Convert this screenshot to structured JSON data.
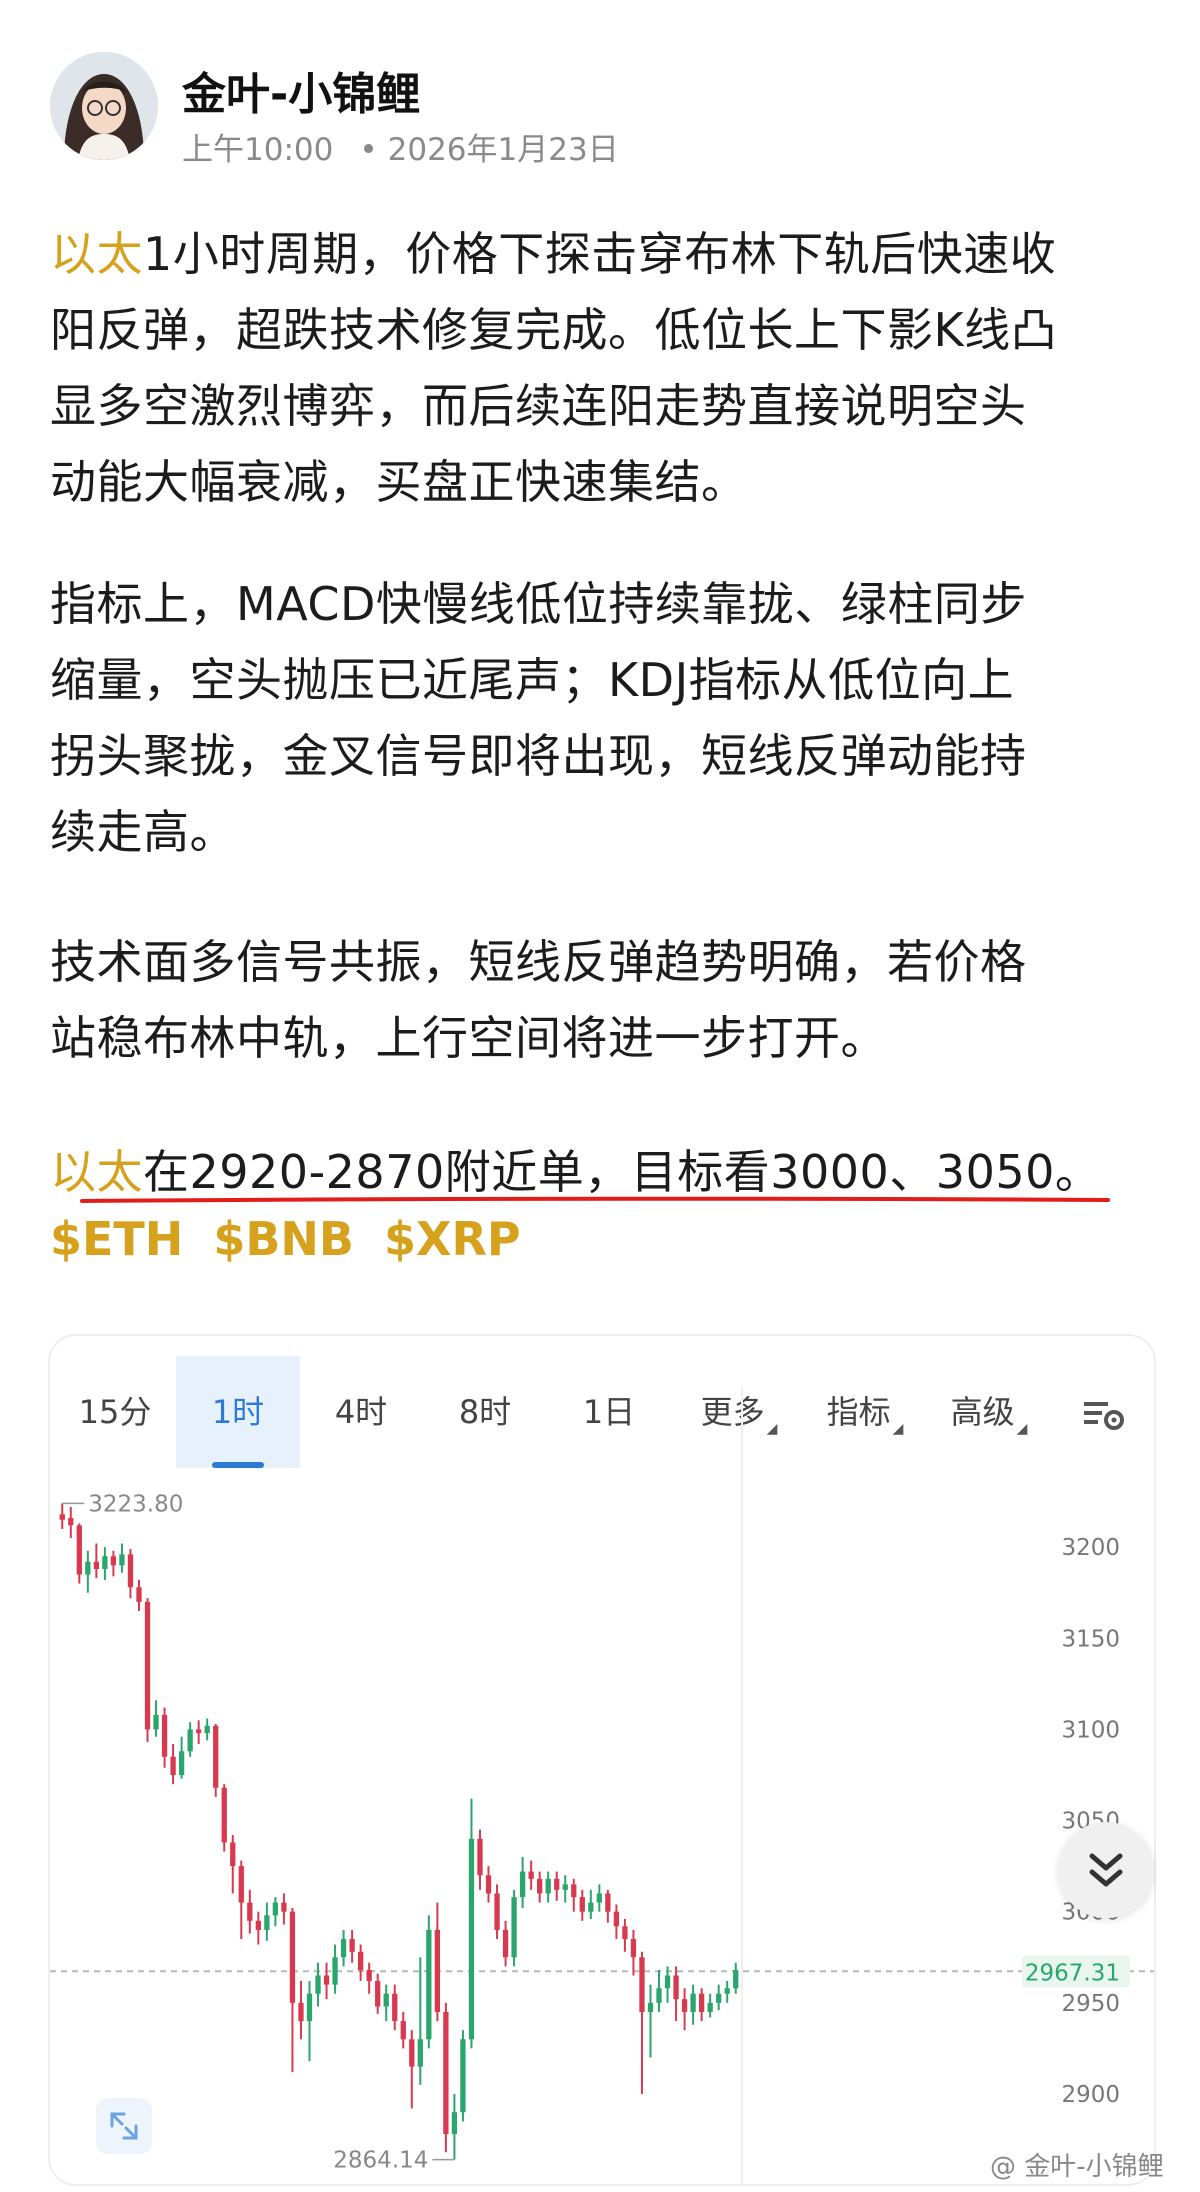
{
  "post": {
    "author": "金叶-小锦鲤",
    "time": "上午10:00",
    "date": "2026年1月23日"
  },
  "content": {
    "p1_highlight": "以太",
    "p1_lines": [
      "1小时周期，价格下探击穿布林下轨后快速收",
      "阳反弹，超跌技术修复完成。低位长上下影K线凸",
      "显多空激烈博弈，而后续连阳走势直接说明空头",
      "动能大幅衰减，买盘正快速集结。"
    ],
    "p2_lines": [
      "指标上，MACD快慢线低位持续靠拢、绿柱同步",
      "缩量，空头抛压已近尾声；KDJ指标从低位向上",
      "拐头聚拢，金叉信号即将出现，短线反弹动能持",
      "续走高。"
    ],
    "p3_lines": [
      "技术面多信号共振，短线反弹趋势明确，若价格",
      "站稳布林中轨，上行空间将进一步打开。"
    ],
    "p4_highlight": "以太",
    "p4_text": "在2920-2870附近单，目标看3000、3050。",
    "tags": [
      "$ETH",
      "$BNB",
      "$XRP"
    ]
  },
  "chart_ui": {
    "tabs": [
      "15分",
      "1时",
      "4时",
      "8时",
      "1日",
      "更多",
      "指标",
      "高级"
    ],
    "active_tab": "1时",
    "settings_icon": "chart-settings-icon",
    "scroll_icon": "double-chevron-down-icon",
    "expand_icon": "expand-arrows-icon",
    "watermark": "@ 金叶-小锦鲤",
    "colors": {
      "up": "#2aa56b",
      "down": "#d9394f",
      "accent": "#d6a21e",
      "active_tab": "#2b7bd6"
    }
  },
  "chart_data": {
    "type": "candlestick",
    "title": "",
    "xlabel": "",
    "ylabel": "",
    "ylim": [
      2855,
      3250
    ],
    "y_ticks": [
      3200,
      3150,
      3100,
      3050,
      3000,
      2950,
      2900
    ],
    "y_tick_labels": [
      "3200",
      "3150",
      "3100",
      "3050",
      "3000",
      "2950",
      "2900"
    ],
    "high_label": "3223.80",
    "low_label": "2864.14",
    "current_price": 2967.31,
    "current_price_label": "2967.31",
    "grid": false,
    "candles": [
      {
        "o": 3218,
        "c": 3215,
        "h": 3224,
        "l": 3210
      },
      {
        "o": 3216,
        "c": 3212,
        "h": 3222,
        "l": 3205
      },
      {
        "o": 3212,
        "c": 3185,
        "h": 3213,
        "l": 3180
      },
      {
        "o": 3185,
        "c": 3192,
        "h": 3198,
        "l": 3175
      },
      {
        "o": 3192,
        "c": 3188,
        "h": 3202,
        "l": 3183
      },
      {
        "o": 3188,
        "c": 3195,
        "h": 3200,
        "l": 3182
      },
      {
        "o": 3195,
        "c": 3190,
        "h": 3198,
        "l": 3184
      },
      {
        "o": 3190,
        "c": 3196,
        "h": 3202,
        "l": 3186
      },
      {
        "o": 3196,
        "c": 3178,
        "h": 3199,
        "l": 3172
      },
      {
        "o": 3178,
        "c": 3170,
        "h": 3182,
        "l": 3165
      },
      {
        "o": 3170,
        "c": 3100,
        "h": 3172,
        "l": 3093
      },
      {
        "o": 3100,
        "c": 3108,
        "h": 3116,
        "l": 3096
      },
      {
        "o": 3108,
        "c": 3085,
        "h": 3112,
        "l": 3079
      },
      {
        "o": 3085,
        "c": 3075,
        "h": 3092,
        "l": 3070
      },
      {
        "o": 3075,
        "c": 3088,
        "h": 3096,
        "l": 3073
      },
      {
        "o": 3088,
        "c": 3100,
        "h": 3104,
        "l": 3085
      },
      {
        "o": 3100,
        "c": 3098,
        "h": 3105,
        "l": 3092
      },
      {
        "o": 3098,
        "c": 3102,
        "h": 3106,
        "l": 3094
      },
      {
        "o": 3102,
        "c": 3068,
        "h": 3103,
        "l": 3063
      },
      {
        "o": 3068,
        "c": 3038,
        "h": 3070,
        "l": 3033
      },
      {
        "o": 3038,
        "c": 3025,
        "h": 3042,
        "l": 3010
      },
      {
        "o": 3025,
        "c": 3005,
        "h": 3028,
        "l": 2985
      },
      {
        "o": 3005,
        "c": 2995,
        "h": 3012,
        "l": 2988
      },
      {
        "o": 2995,
        "c": 2990,
        "h": 3000,
        "l": 2982
      },
      {
        "o": 2990,
        "c": 2998,
        "h": 3005,
        "l": 2984
      },
      {
        "o": 2998,
        "c": 3005,
        "h": 3008,
        "l": 2992
      },
      {
        "o": 3005,
        "c": 3000,
        "h": 3010,
        "l": 2993
      },
      {
        "o": 3000,
        "c": 2950,
        "h": 3002,
        "l": 2912
      },
      {
        "o": 2950,
        "c": 2940,
        "h": 2962,
        "l": 2930
      },
      {
        "o": 2940,
        "c": 2955,
        "h": 2962,
        "l": 2918
      },
      {
        "o": 2955,
        "c": 2965,
        "h": 2972,
        "l": 2948
      },
      {
        "o": 2965,
        "c": 2960,
        "h": 2972,
        "l": 2952
      },
      {
        "o": 2960,
        "c": 2975,
        "h": 2982,
        "l": 2955
      },
      {
        "o": 2975,
        "c": 2985,
        "h": 2990,
        "l": 2970
      },
      {
        "o": 2985,
        "c": 2978,
        "h": 2990,
        "l": 2972
      },
      {
        "o": 2978,
        "c": 2968,
        "h": 2982,
        "l": 2962
      },
      {
        "o": 2968,
        "c": 2962,
        "h": 2972,
        "l": 2955
      },
      {
        "o": 2962,
        "c": 2948,
        "h": 2966,
        "l": 2944
      },
      {
        "o": 2948,
        "c": 2955,
        "h": 2960,
        "l": 2940
      },
      {
        "o": 2955,
        "c": 2940,
        "h": 2960,
        "l": 2935
      },
      {
        "o": 2940,
        "c": 2930,
        "h": 2945,
        "l": 2925
      },
      {
        "o": 2930,
        "c": 2915,
        "h": 2935,
        "l": 2892
      },
      {
        "o": 2915,
        "c": 2930,
        "h": 2975,
        "l": 2905
      },
      {
        "o": 2930,
        "c": 2990,
        "h": 2998,
        "l": 2925
      },
      {
        "o": 2990,
        "c": 2945,
        "h": 3005,
        "l": 2940
      },
      {
        "o": 2945,
        "c": 2878,
        "h": 2950,
        "l": 2868
      },
      {
        "o": 2878,
        "c": 2890,
        "h": 2900,
        "l": 2864
      },
      {
        "o": 2890,
        "c": 2930,
        "h": 2935,
        "l": 2885
      },
      {
        "o": 2930,
        "c": 3040,
        "h": 3062,
        "l": 2925
      },
      {
        "o": 3040,
        "c": 3020,
        "h": 3045,
        "l": 3012
      },
      {
        "o": 3020,
        "c": 3010,
        "h": 3025,
        "l": 3005
      },
      {
        "o": 3010,
        "c": 2990,
        "h": 3015,
        "l": 2985
      },
      {
        "o": 2990,
        "c": 2975,
        "h": 2995,
        "l": 2970
      },
      {
        "o": 2975,
        "c": 3008,
        "h": 3012,
        "l": 2970
      },
      {
        "o": 3008,
        "c": 3022,
        "h": 3030,
        "l": 3002
      },
      {
        "o": 3022,
        "c": 3018,
        "h": 3028,
        "l": 3012
      },
      {
        "o": 3018,
        "c": 3010,
        "h": 3022,
        "l": 3005
      },
      {
        "o": 3010,
        "c": 3018,
        "h": 3022,
        "l": 3005
      },
      {
        "o": 3018,
        "c": 3012,
        "h": 3022,
        "l": 3006
      },
      {
        "o": 3012,
        "c": 3015,
        "h": 3020,
        "l": 3005
      },
      {
        "o": 3015,
        "c": 3008,
        "h": 3018,
        "l": 3000
      },
      {
        "o": 3008,
        "c": 3000,
        "h": 3012,
        "l": 2995
      },
      {
        "o": 3000,
        "c": 3005,
        "h": 3012,
        "l": 2996
      },
      {
        "o": 3005,
        "c": 3010,
        "h": 3015,
        "l": 3000
      },
      {
        "o": 3010,
        "c": 3000,
        "h": 3012,
        "l": 2994
      },
      {
        "o": 3000,
        "c": 2992,
        "h": 3004,
        "l": 2985
      },
      {
        "o": 2992,
        "c": 2985,
        "h": 2996,
        "l": 2978
      },
      {
        "o": 2985,
        "c": 2975,
        "h": 2990,
        "l": 2965
      },
      {
        "o": 2975,
        "c": 2945,
        "h": 2978,
        "l": 2900
      },
      {
        "o": 2945,
        "c": 2950,
        "h": 2960,
        "l": 2920
      },
      {
        "o": 2950,
        "c": 2958,
        "h": 2968,
        "l": 2945
      },
      {
        "o": 2958,
        "c": 2965,
        "h": 2970,
        "l": 2950
      },
      {
        "o": 2965,
        "c": 2952,
        "h": 2970,
        "l": 2940
      },
      {
        "o": 2952,
        "c": 2945,
        "h": 2958,
        "l": 2935
      },
      {
        "o": 2945,
        "c": 2955,
        "h": 2960,
        "l": 2938
      },
      {
        "o": 2955,
        "c": 2945,
        "h": 2958,
        "l": 2940
      },
      {
        "o": 2945,
        "c": 2950,
        "h": 2955,
        "l": 2942
      },
      {
        "o": 2950,
        "c": 2955,
        "h": 2960,
        "l": 2946
      },
      {
        "o": 2955,
        "c": 2958,
        "h": 2962,
        "l": 2950
      },
      {
        "o": 2958,
        "c": 2968,
        "h": 2972,
        "l": 2955
      }
    ]
  }
}
